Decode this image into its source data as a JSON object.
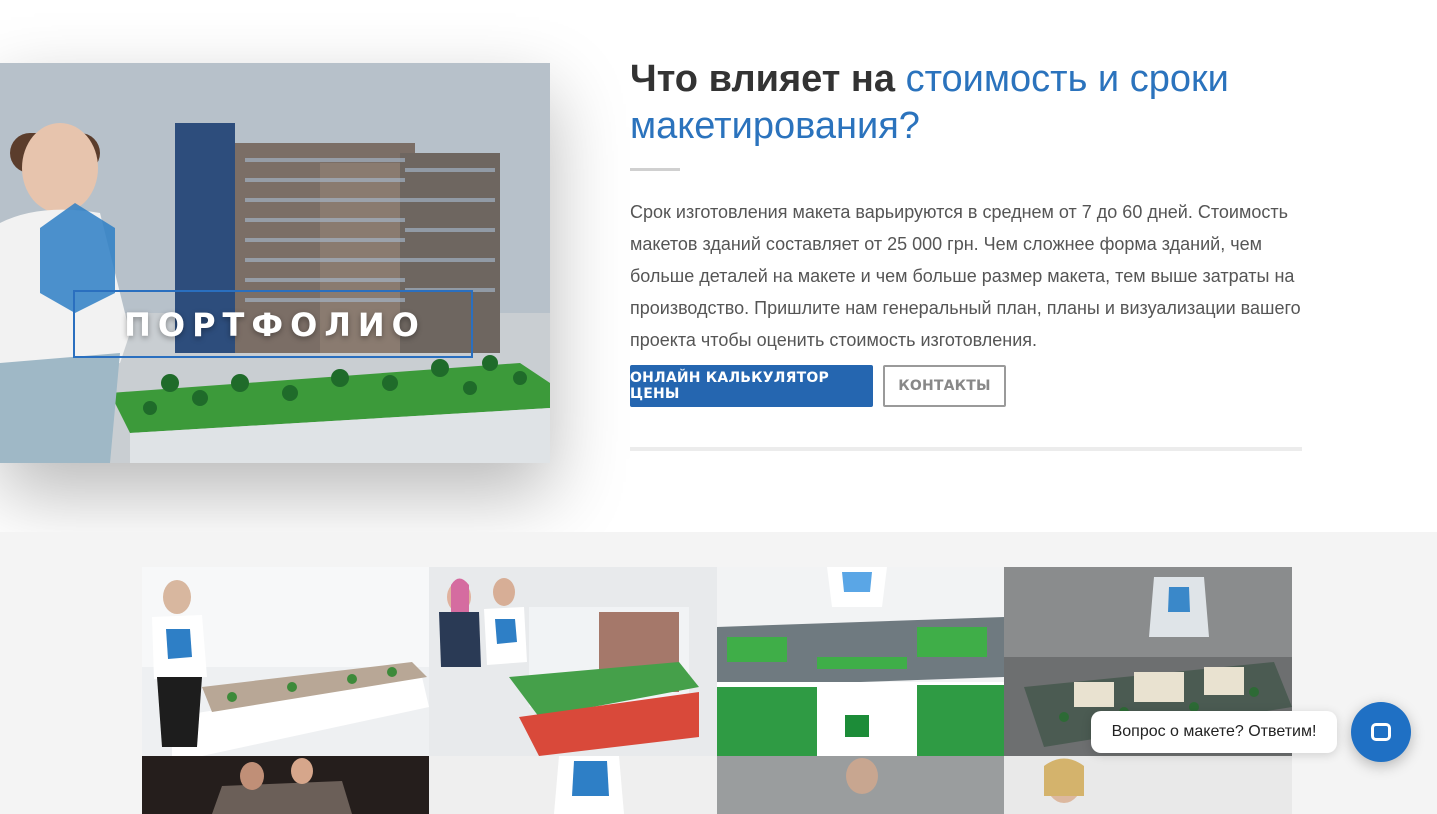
{
  "hero": {
    "portfolio_label": "ПОРТФОЛИО"
  },
  "info": {
    "heading_plain": "Что влияет на",
    "heading_accent": "стоимость и сроки макетирования?",
    "body": "Срок изготовления макета варьируются в среднем от 7 до 60 дней. Стоимость макетов зданий составляет от 25 000 грн. Чем сложнее форма зданий, чем больше деталей на макете и чем больше размер макета, тем выше затраты на производство. Пришлите нам генеральный план, планы и визуализации вашего проекта чтобы оценить стоимость изготовления.",
    "calculator_button": "ОНЛАЙН КАЛЬКУЛЯТОР ЦЕНЫ",
    "contacts_button": "КОНТАКТЫ"
  },
  "chat": {
    "bubble_text": "Вопрос о макете? Ответим!",
    "icon": "chat-icon"
  },
  "colors": {
    "accent": "#2b73bd",
    "button_primary": "#2566b0",
    "chat_button": "#1f70c4"
  },
  "gallery": {
    "icon": "photo-thumbnail"
  }
}
